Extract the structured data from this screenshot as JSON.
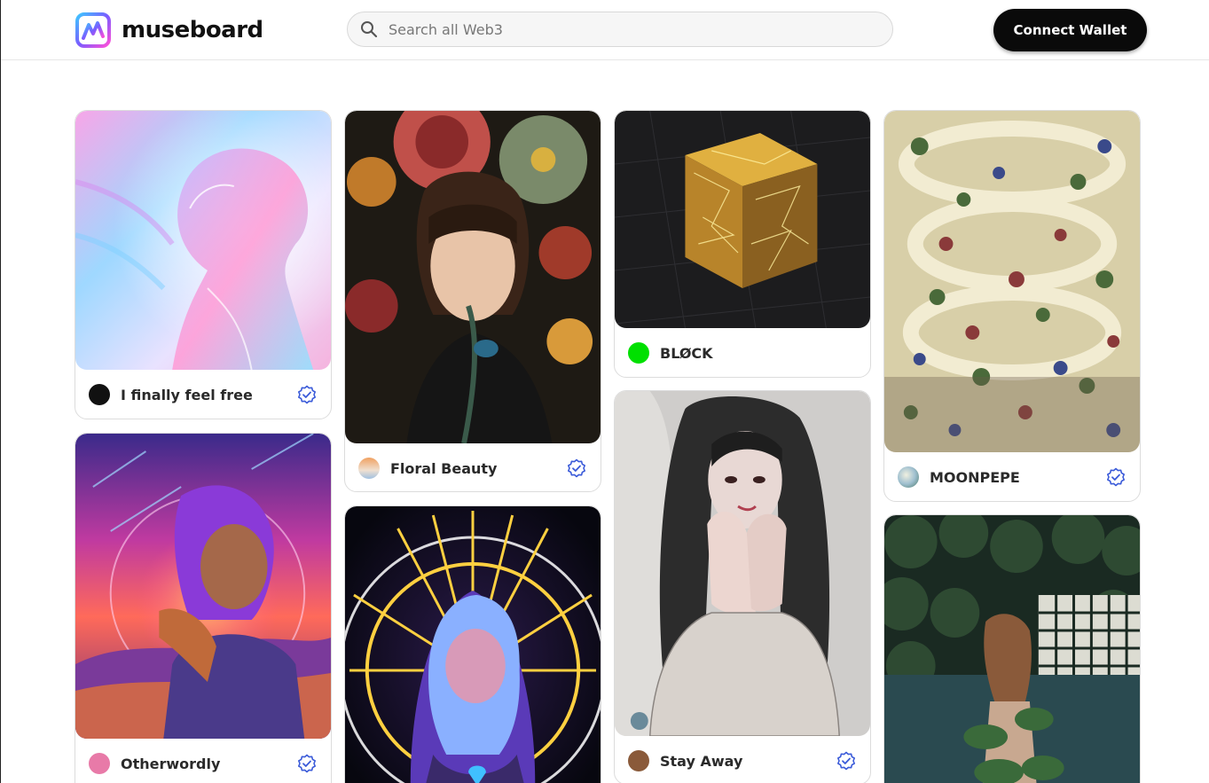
{
  "header": {
    "logo_text": "museboard",
    "search_placeholder": "Search all Web3",
    "connect_label": "Connect Wallet"
  },
  "cards": [
    {
      "title": "I finally feel free",
      "verified": true,
      "avatar_color": "#111111"
    },
    {
      "title": "Otherwordly",
      "verified": true,
      "avatar_color": "#e87aa8"
    },
    {
      "title": "Floral Beauty",
      "verified": true,
      "avatar_color": "#d8a070"
    },
    {
      "title": "",
      "verified": false,
      "avatar_color": ""
    },
    {
      "title": "BLØCK",
      "verified": false,
      "avatar_color": "#00e000"
    },
    {
      "title": "Stay Away",
      "verified": true,
      "avatar_color": "#8a5a3a"
    },
    {
      "title": "MOONPEPE",
      "verified": true,
      "avatar_color": "#6a9ab0"
    },
    {
      "title": "",
      "verified": false,
      "avatar_color": ""
    }
  ],
  "colors": {
    "accent": "#3b5bd9",
    "button_bg": "#0a0a0a"
  }
}
